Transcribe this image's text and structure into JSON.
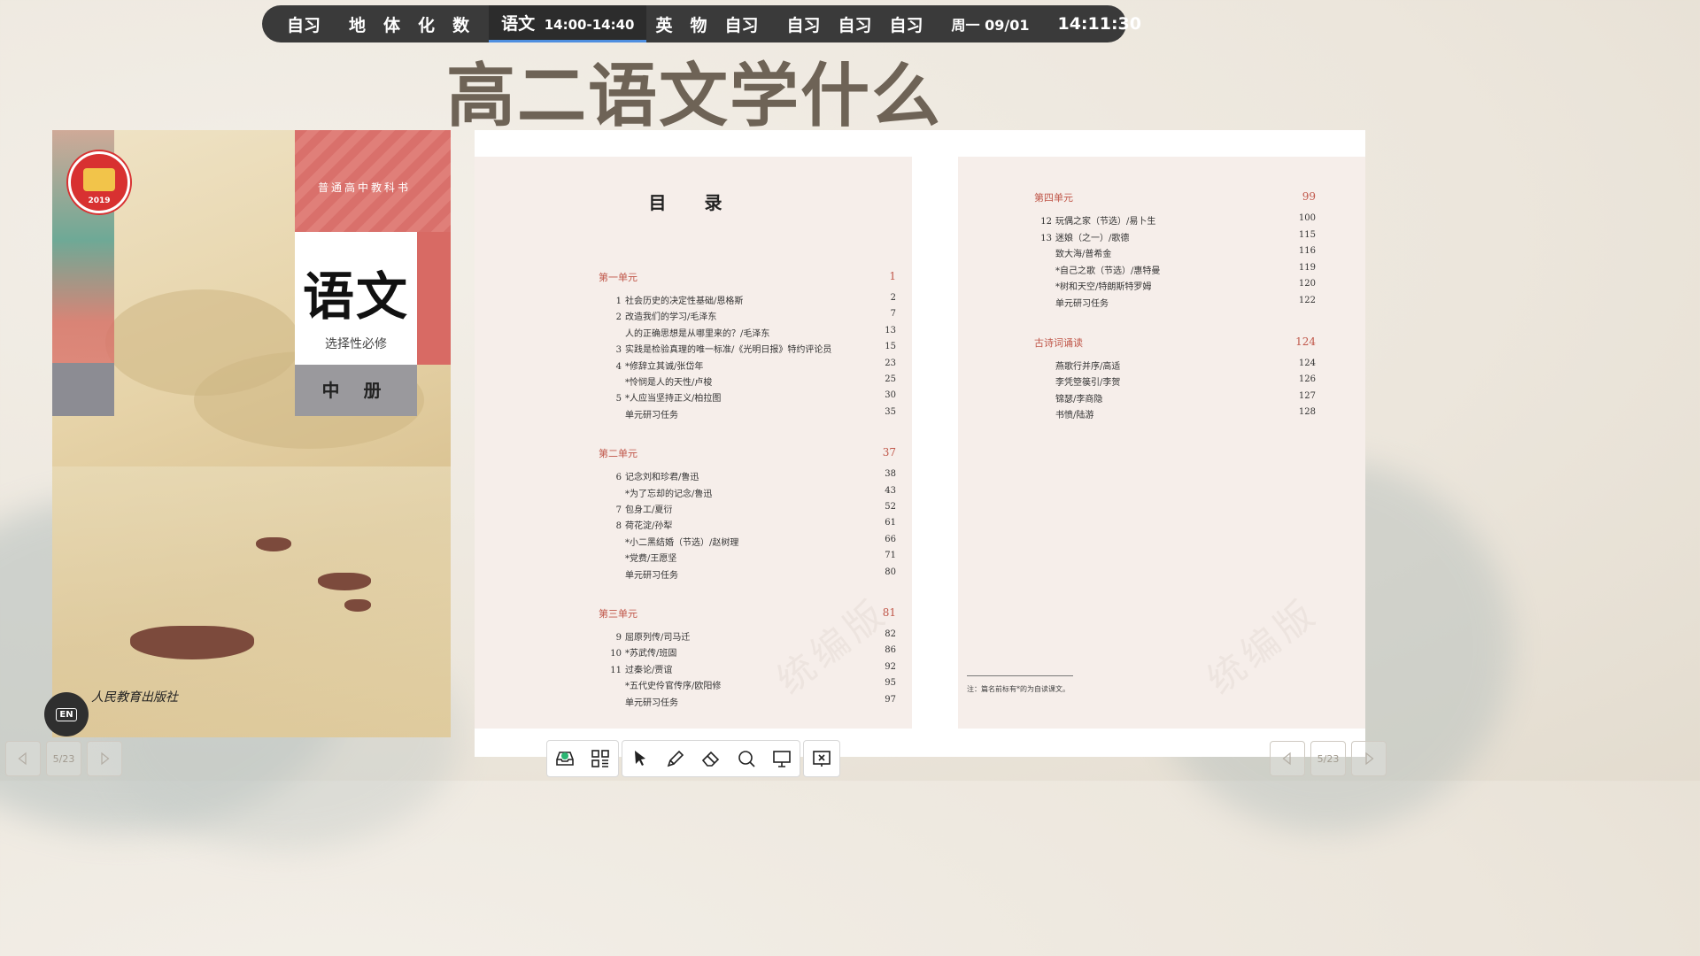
{
  "schedule": {
    "groups": [
      [
        "自习"
      ],
      [
        "地",
        "体",
        "化",
        "数"
      ],
      [
        "语文",
        "英",
        "物",
        "自习"
      ],
      [
        "自习",
        "自习",
        "自习"
      ]
    ],
    "current_time": "14:00-14:40",
    "date": "周一 09/01",
    "clock": "14:11:30"
  },
  "slide": {
    "title": "高二语文学什么"
  },
  "cover": {
    "series": "普通高中教科书",
    "subject": "语文",
    "subtitle": "选择性必修",
    "volume": "中 册",
    "badge_year": "2019",
    "publisher": "人民教育出版社"
  },
  "toc": {
    "title": "目 录",
    "left_sections": [
      {
        "name": "第一单元",
        "page": "1",
        "rows": [
          {
            "num": "1",
            "text": "社会历史的决定性基础/恩格斯",
            "page": "2"
          },
          {
            "num": "2",
            "text": "改造我们的学习/毛泽东",
            "page": "7"
          },
          {
            "num": "",
            "text": "人的正确思想是从哪里来的？/毛泽东",
            "page": "13"
          },
          {
            "num": "3",
            "text": "实践是检验真理的唯一标准/《光明日报》特约评论员",
            "page": "15"
          },
          {
            "num": "4",
            "text": "*修辞立其诚/张岱年",
            "page": "23"
          },
          {
            "num": "",
            "text": "*怜悯是人的天性/卢梭",
            "page": "25"
          },
          {
            "num": "5",
            "text": "*人应当坚持正义/柏拉图",
            "page": "30"
          },
          {
            "num": "",
            "text": "单元研习任务",
            "page": "35"
          }
        ]
      },
      {
        "name": "第二单元",
        "page": "37",
        "rows": [
          {
            "num": "6",
            "text": "记念刘和珍君/鲁迅",
            "page": "38"
          },
          {
            "num": "",
            "text": "*为了忘却的记念/鲁迅",
            "page": "43"
          },
          {
            "num": "7",
            "text": "包身工/夏衍",
            "page": "52"
          },
          {
            "num": "8",
            "text": "荷花淀/孙犁",
            "page": "61"
          },
          {
            "num": "",
            "text": "*小二黑结婚（节选）/赵树理",
            "page": "66"
          },
          {
            "num": "",
            "text": "*党费/王愿坚",
            "page": "71"
          },
          {
            "num": "",
            "text": "单元研习任务",
            "page": "80"
          }
        ]
      },
      {
        "name": "第三单元",
        "page": "81",
        "rows": [
          {
            "num": "9",
            "text": "屈原列传/司马迁",
            "page": "82"
          },
          {
            "num": "10",
            "text": "*苏武传/班固",
            "page": "86"
          },
          {
            "num": "11",
            "text": "过秦论/贾谊",
            "page": "92"
          },
          {
            "num": "",
            "text": "*五代史伶官传序/欧阳修",
            "page": "95"
          },
          {
            "num": "",
            "text": "单元研习任务",
            "page": "97"
          }
        ]
      }
    ],
    "right_sections": [
      {
        "name": "第四单元",
        "page": "99",
        "rows": [
          {
            "num": "12",
            "text": "玩偶之家（节选）/易卜生",
            "page": "100"
          },
          {
            "num": "13",
            "text": "迷娘（之一）/歌德",
            "page": "115"
          },
          {
            "num": "",
            "text": "致大海/普希金",
            "page": "116"
          },
          {
            "num": "",
            "text": "*自己之歌（节选）/惠特曼",
            "page": "119"
          },
          {
            "num": "",
            "text": "*树和天空/特朗斯特罗姆",
            "page": "120"
          },
          {
            "num": "",
            "text": "单元研习任务",
            "page": "122"
          }
        ]
      },
      {
        "name": "古诗词诵读",
        "page": "124",
        "rows": [
          {
            "num": "",
            "text": "燕歌行并序/高适",
            "page": "124"
          },
          {
            "num": "",
            "text": "李凭箜篌引/李贺",
            "page": "126"
          },
          {
            "num": "",
            "text": "锦瑟/李商隐",
            "page": "127"
          },
          {
            "num": "",
            "text": "书愤/陆游",
            "page": "128"
          }
        ]
      }
    ],
    "watermark": "统编版",
    "note": "注：篇名前标有*的为自读课文。"
  },
  "ime": {
    "label": "EN"
  },
  "pager": {
    "label": "5/23"
  },
  "toolbar": {
    "icons": [
      "inbox-icon",
      "apps-grid-icon",
      "pointer-icon",
      "pen-icon",
      "eraser-icon",
      "magnifier-icon",
      "screen-icon",
      "exit-icon"
    ]
  }
}
